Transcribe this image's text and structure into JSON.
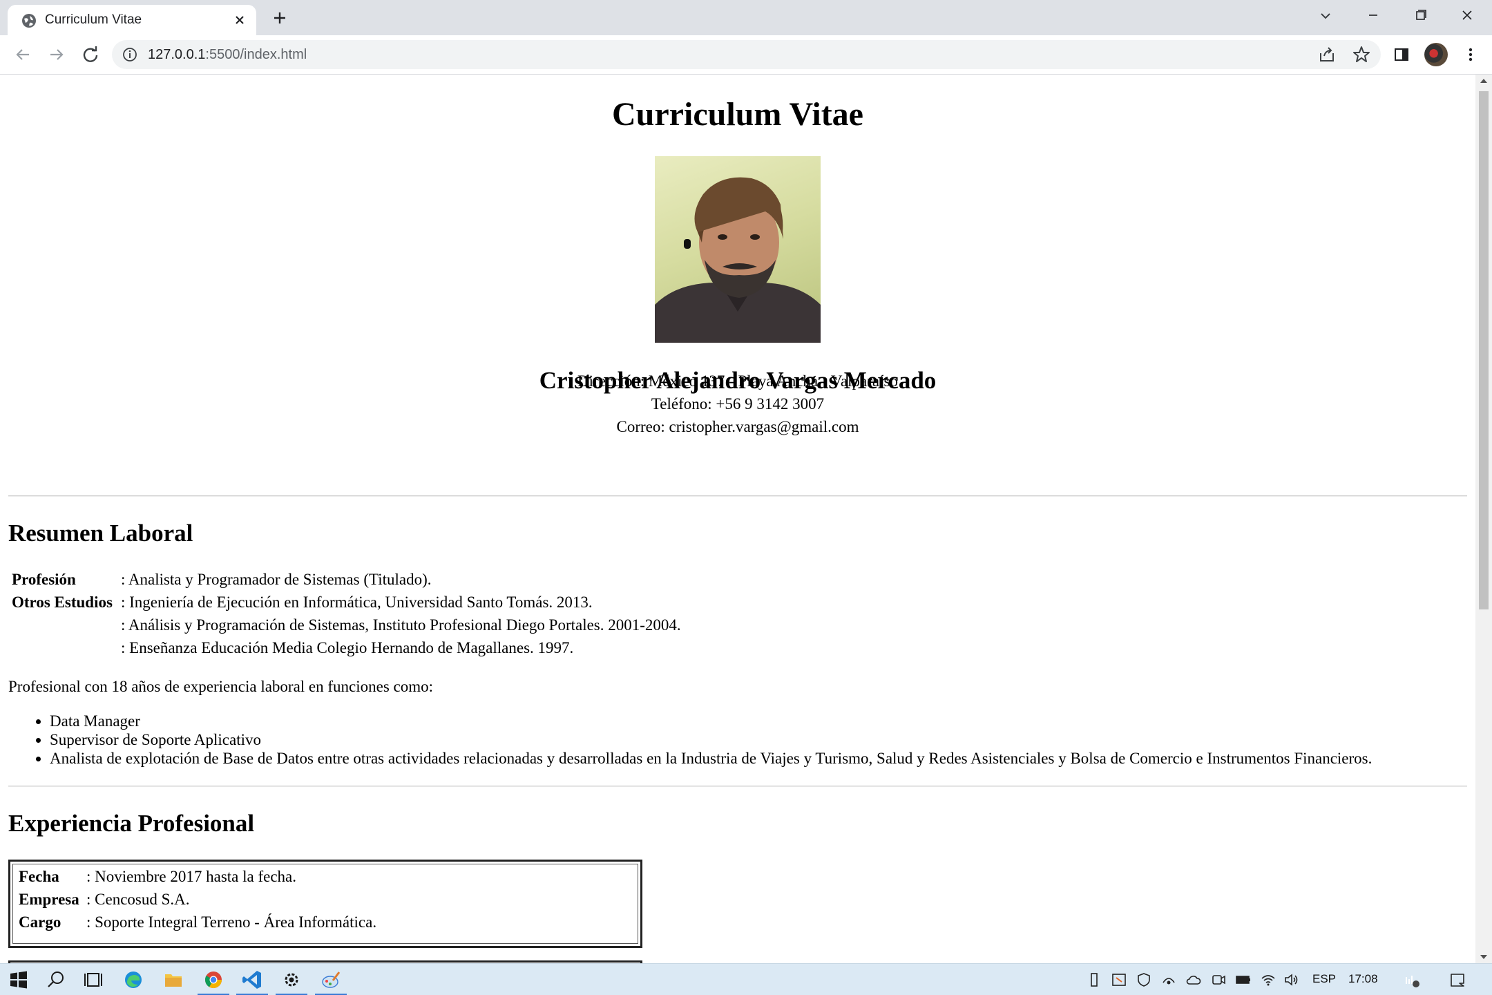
{
  "browser": {
    "tab_title": "Curriculum Vitae",
    "url_host": "127.0.0.1",
    "url_path": ":5500/index.html"
  },
  "page": {
    "title": "Curriculum Vitae",
    "name": "Cristopher Alejandro Vargas Mercado",
    "contact": {
      "address": "Dirección: México 137 - Playa Ancha - Valparaíso",
      "phone": "Teléfono: +56 9 3142 3007",
      "email": "Correo: cristopher.vargas@gmail.com"
    },
    "resumen": {
      "heading": "Resumen Laboral",
      "profesion_label": "Profesión",
      "profesion_value": ": Analista y Programador de Sistemas (Titulado).",
      "estudios_label": "Otros Estudios",
      "estudios": [
        ": Ingeniería de Ejecución en Informática, Universidad Santo Tomás. 2013.",
        ": Análisis y Programación de Sistemas, Instituto Profesional Diego Portales. 2001-2004.",
        ": Enseñanza Educación Media Colegio Hernando de Magallanes. 1997."
      ],
      "intro": "Profesional con 18 años de experiencia laboral en funciones como:",
      "duties": [
        "Data Manager",
        "Supervisor de Soporte Aplicativo",
        "Analista de explotación de Base de Datos entre otras actividades relacionadas y desarrolladas en la Industria de Viajes y Turismo, Salud y Redes Asistenciales y Bolsa de Comercio e Instrumentos Financieros."
      ]
    },
    "experiencia": {
      "heading": "Experiencia Profesional",
      "job": {
        "fecha_label": "Fecha",
        "fecha_value": ": Noviembre 2017 hasta la fecha.",
        "empresa_label": "Empresa",
        "empresa_value": ": Cencosud S.A.",
        "cargo_label": "Cargo",
        "cargo_value": ": Soporte Integral Terreno - Área Informática."
      }
    }
  },
  "taskbar": {
    "language": "ESP",
    "time": "17:08"
  },
  "icons": [
    "globe-icon",
    "close-icon",
    "plus-icon",
    "chevron-down-icon",
    "minimize-icon",
    "maximize-icon",
    "back-icon",
    "forward-icon",
    "reload-icon",
    "info-icon",
    "share-icon",
    "star-icon",
    "side-panel-icon",
    "menu-icon"
  ]
}
